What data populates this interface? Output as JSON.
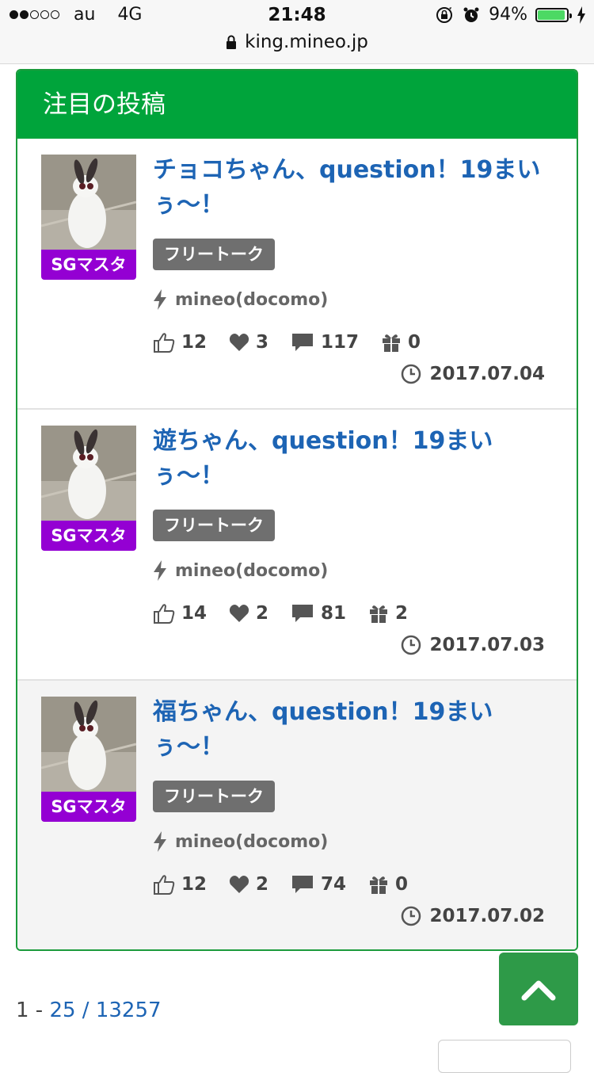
{
  "status_bar": {
    "carrier": "au",
    "network": "4G",
    "time": "21:48",
    "battery": "94%",
    "battery_level": 0.94,
    "signal_bars": 2,
    "icons": [
      "orientation-lock-icon",
      "alarm-icon",
      "charging-icon"
    ]
  },
  "browser": {
    "url": "king.mineo.jp",
    "icon": "lock-icon"
  },
  "panel": {
    "title": "注目の投稿",
    "posts": [
      {
        "title": "チョコちゃん、question！19まいぅ〜！",
        "badge": "SGマスタ",
        "tag": "フリートーク",
        "device": "mineo(docomo)",
        "likes": "12",
        "hearts": "3",
        "comments": "117",
        "gifts": "0",
        "date": "2017.07.04"
      },
      {
        "title": "遊ちゃん、question！19まいぅ〜！",
        "badge": "SGマスタ",
        "tag": "フリートーク",
        "device": "mineo(docomo)",
        "likes": "14",
        "hearts": "2",
        "comments": "81",
        "gifts": "2",
        "date": "2017.07.03"
      },
      {
        "title": "福ちゃん、question！19まいぅ〜！",
        "badge": "SGマスタ",
        "tag": "フリートーク",
        "device": "mineo(docomo)",
        "likes": "12",
        "hearts": "2",
        "comments": "74",
        "gifts": "0",
        "date": "2017.07.02"
      }
    ]
  },
  "pagination": {
    "start": "1 - ",
    "end": "25",
    "separator": " / ",
    "total": "13257"
  },
  "colors": {
    "header_green": "#00a43b",
    "title_blue": "#1d64b4",
    "badge_purple": "#9400d3",
    "tag_gray": "#6f6f6f",
    "totop_green": "#2e9a48"
  }
}
